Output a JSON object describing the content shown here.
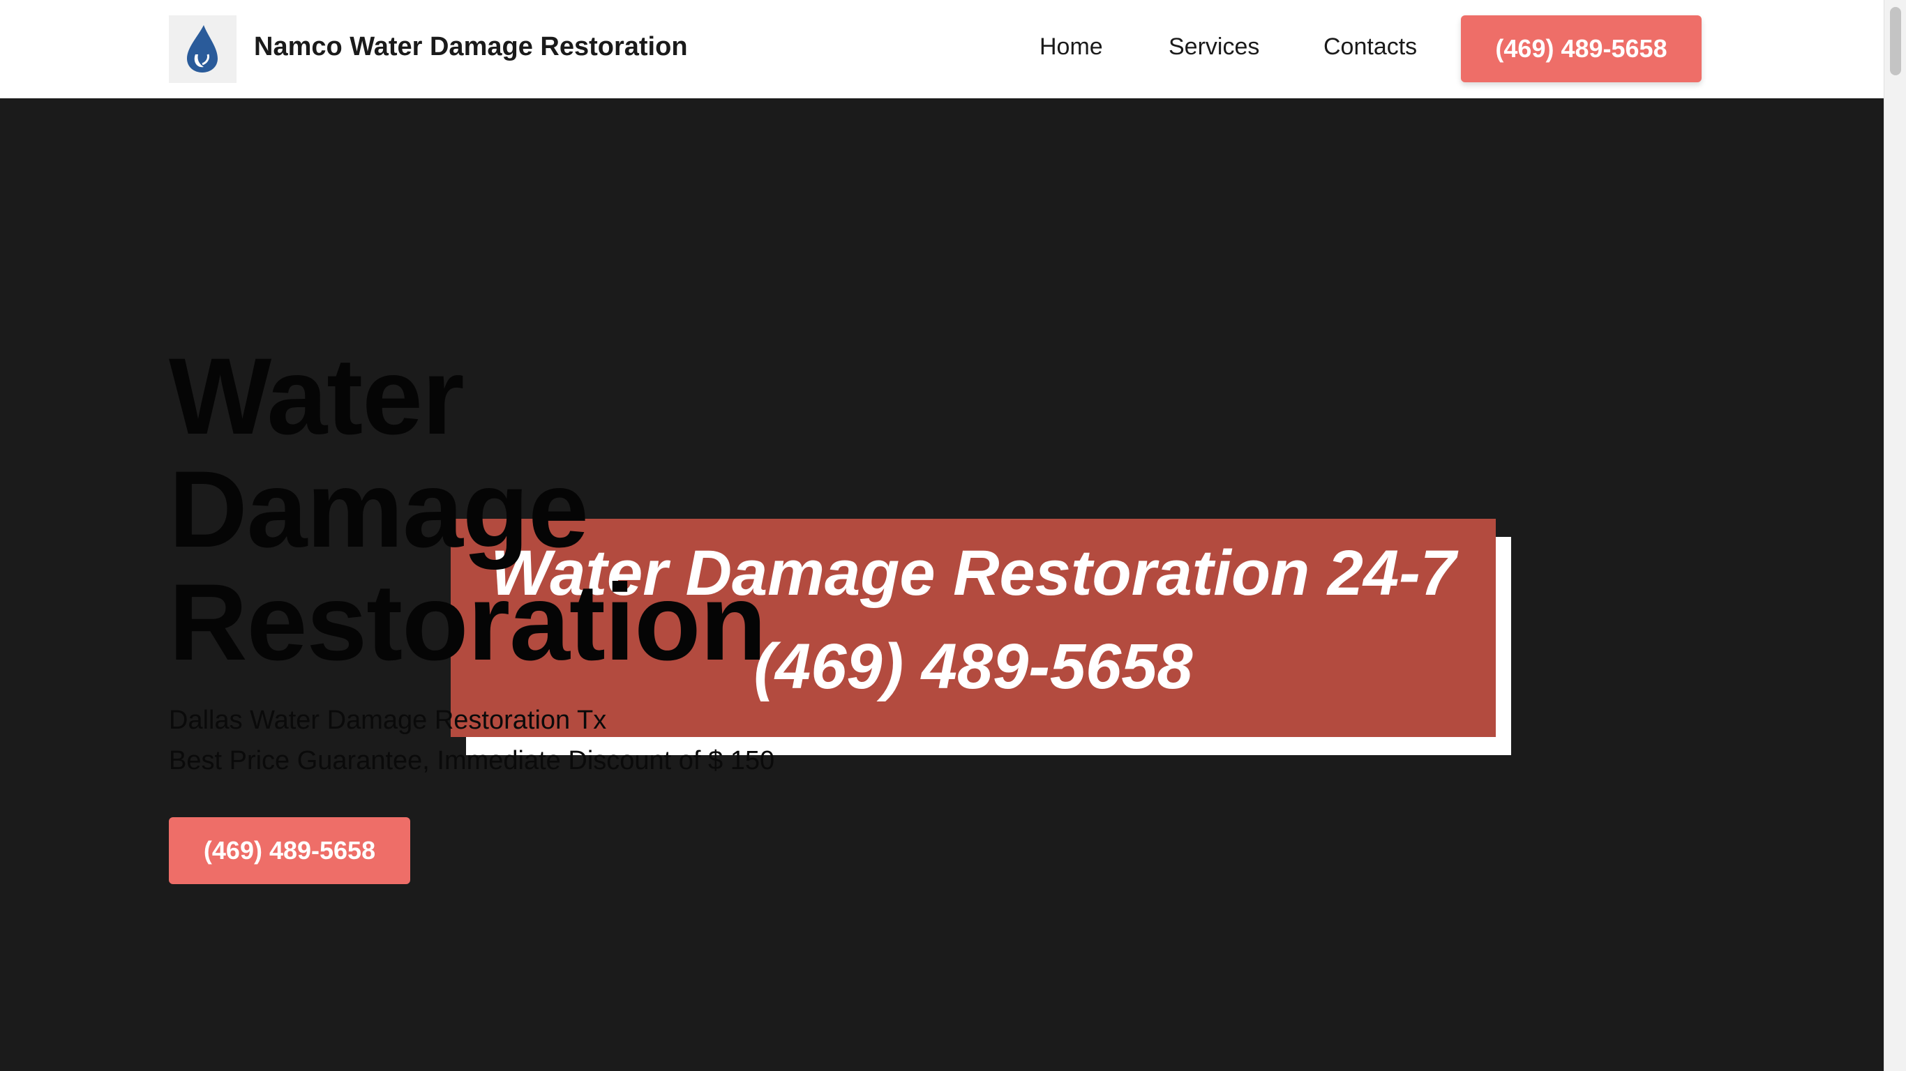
{
  "header": {
    "brand_name": "Namco Water Damage Restoration",
    "logo_icon": "water-drop-icon",
    "nav": {
      "home": "Home",
      "services": "Services",
      "contacts": "Contacts"
    },
    "phone_button": "(469) 489-5658"
  },
  "hero": {
    "title_lines": [
      "Water",
      "Damage",
      "Restoration"
    ],
    "subtitle_line_1": "Dallas Water Damage Restoration Tx",
    "subtitle_line_2": "Best Price Guarantee, Immediate Discount of $ 150",
    "phone_button": "(469) 489-5658",
    "banner": {
      "line_1": "Water Damage Restoration 24-7",
      "line_2": "(469) 489-5658"
    }
  },
  "colors": {
    "accent": "#ee6e68",
    "banner": "#b34b3f",
    "hero_background": "#1b1b1b",
    "logo_blue": "#2a5b9a"
  }
}
